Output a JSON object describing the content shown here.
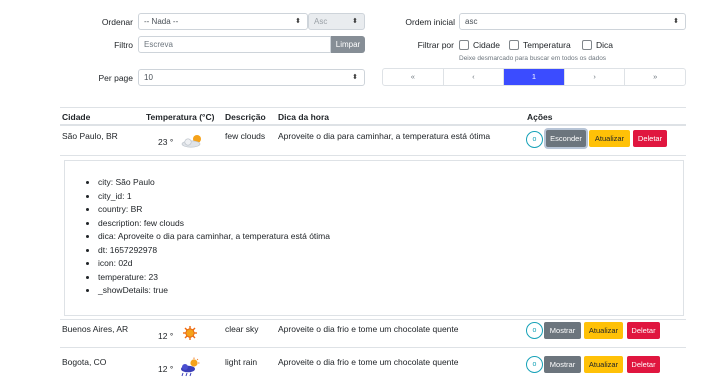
{
  "filters": {
    "ordenar_label": "Ordenar",
    "ordenar_value": "-- Nada --",
    "direction_value": "Asc",
    "ordem_inicial_label": "Ordem inicial",
    "ordem_inicial_value": "asc",
    "filtro_label": "Filtro",
    "filtro_placeholder": "Escreva",
    "limpar_label": "Limpar",
    "filtrar_por_label": "Filtrar por",
    "checkboxes": [
      "Cidade",
      "Temperatura",
      "Dica"
    ],
    "hint": "Deixe desmarcado para buscar em todos os dados",
    "per_page_label": "Per page",
    "per_page_value": "10"
  },
  "pagination": [
    "«",
    "‹",
    "1",
    "›",
    "»"
  ],
  "table": {
    "headers": [
      "Cidade",
      "Temperatura (°C)",
      "Descrição",
      "Dica da hora",
      "Ações"
    ],
    "rows": [
      {
        "city": "São Paulo, BR",
        "temp": "23 °",
        "icon": "few-clouds-icon",
        "description": "few clouds",
        "tip": "Aproveite o dia para caminhar, a temperatura está ótima",
        "toggle": "Esconder"
      },
      {
        "city": "Buenos Aires, AR",
        "temp": "12 °",
        "icon": "sun-icon",
        "description": "clear sky",
        "tip": "Aproveite o dia frio e tome um chocolate quente",
        "toggle": "Mostrar"
      },
      {
        "city": "Bogota, CO",
        "temp": "12 °",
        "icon": "rain-icon",
        "description": "light rain",
        "tip": "Aproveite o dia frio e tome um chocolate quente",
        "toggle": "Mostrar"
      }
    ],
    "circle_label": "o",
    "update_label": "Atualizar",
    "delete_label": "Deletar"
  },
  "details": [
    "city: São Paulo",
    "city_id: 1",
    "country: BR",
    "description: few clouds",
    "dica: Aproveite o dia para caminhar, a temperatura está ótima",
    "dt: 1657292978",
    "icon: 02d",
    "temperature: 23",
    "_showDetails: true"
  ],
  "colors": {
    "accent": "#3b4cff",
    "info": "#17a2b8",
    "warning": "#ffc107",
    "danger": "#e0163f",
    "secondary": "#6c757d"
  }
}
